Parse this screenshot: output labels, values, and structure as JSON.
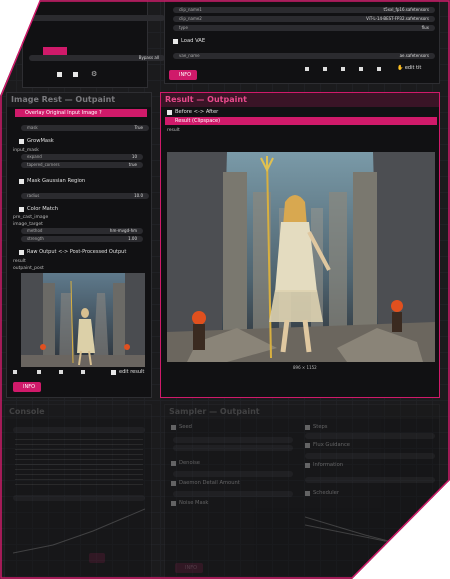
{
  "top_left_node": {
    "rows": [
      {
        "label": "",
        "value": "Bypass all"
      },
      {
        "label": "",
        "value": "Bypass all"
      }
    ]
  },
  "top_right_node": {
    "widgets": [
      {
        "label": "clip_name1",
        "value": "t5xxl_fp16.safetensors"
      },
      {
        "label": "clip_name2",
        "value": "ViT-L-14-BEST-FP32.safetensors"
      },
      {
        "label": "type",
        "value": "flux"
      }
    ],
    "load_vae_label": "Load VAE",
    "vae_widget": {
      "label": "vae_name",
      "value": "ae.safetensors"
    },
    "info_button": "INFO",
    "edit_label": "edit tit"
  },
  "left_node": {
    "title": "Image Rest — Outpaint",
    "overlay_label": "Overlay Original Input Image ?",
    "mask_label": "mask",
    "mask_value": "True",
    "grow_mask_label": "GrowMask",
    "input_mask_label": "input_mask",
    "expand_label": "expand",
    "expand_value": "10",
    "tapered_label": "tapered_corners",
    "tapered_value": "true",
    "mask_blur_label": "Mask Gaussian Region",
    "radius_label": "radius",
    "radius_value": "10.0",
    "color_match_label": "Color Match",
    "color_inputs": [
      "pre_cast_image",
      "image_target"
    ],
    "method_label": "method",
    "method_value": "hm-mvgd-hm",
    "strength_label": "strength",
    "strength_value": "1.00",
    "raw_output_label": "Raw Output <-> Post-Processed Output",
    "result_inputs": [
      "result",
      "outpaint_post"
    ],
    "edit_result": "edit result",
    "info_button": "INFO"
  },
  "result_node": {
    "title": "Result — Outpaint",
    "before_after_label": "Before <-> After",
    "result_label": "Result (Clipspace)",
    "output_label": "result",
    "size_caption": "896 × 1152"
  },
  "bottom_left_node": {
    "title": "Console"
  },
  "bottom_right_node": {
    "title": "Sampler — Outpaint",
    "seed_label": "Seed",
    "denoise_label": "Denoise",
    "detail_label": "Daemon Detail Amount",
    "noise_label": "Noise Mask",
    "steps_label": "Steps",
    "guidance_label": "Flux Guidance",
    "info_label": "Information",
    "scheduler_label": "Scheduler",
    "info_button": "INFO"
  },
  "colors": {
    "accent": "#d01a6a",
    "canvas": "#1b1b1d",
    "node": "#111113"
  }
}
